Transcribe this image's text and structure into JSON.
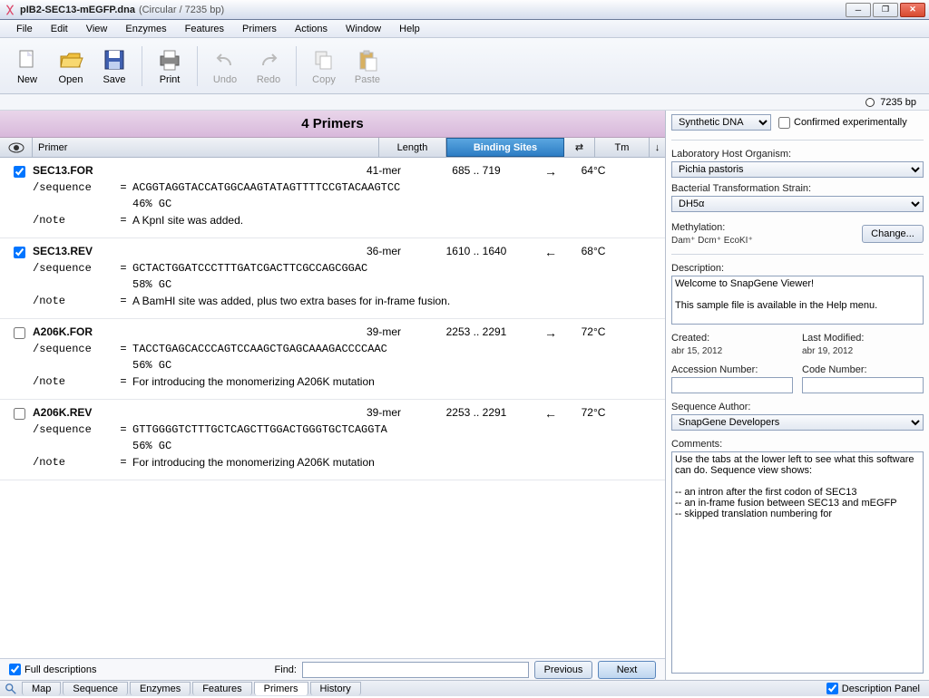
{
  "window": {
    "title_main": "pIB2-SEC13-mEGFP.dna",
    "title_sub": "(Circular / 7235 bp)"
  },
  "menu": [
    "File",
    "Edit",
    "View",
    "Enzymes",
    "Features",
    "Primers",
    "Actions",
    "Window",
    "Help"
  ],
  "toolbar": [
    {
      "label": "New",
      "icon": "new-icon",
      "disabled": false
    },
    {
      "label": "Open",
      "icon": "open-icon",
      "disabled": false
    },
    {
      "label": "Save",
      "icon": "save-icon",
      "disabled": false
    },
    {
      "label": "Print",
      "icon": "print-icon",
      "disabled": false
    },
    {
      "label": "Undo",
      "icon": "undo-icon",
      "disabled": true
    },
    {
      "label": "Redo",
      "icon": "redo-icon",
      "disabled": true
    },
    {
      "label": "Copy",
      "icon": "copy-icon",
      "disabled": true
    },
    {
      "label": "Paste",
      "icon": "paste-icon",
      "disabled": true
    }
  ],
  "infobar": {
    "size": "7235 bp"
  },
  "pane_header": "4 Primers",
  "columns": {
    "primer": "Primer",
    "length": "Length",
    "binding": "Binding Sites",
    "direction": "⇄",
    "tm": "Tm",
    "scroll": "↓"
  },
  "primers": [
    {
      "checked": true,
      "name": "SEC13.FOR",
      "length": "41-mer",
      "binding": "685  ..   719",
      "dir": "→",
      "tm": "64°C",
      "sequence": "ACGGTAGGTACCATGGCAAGTATAGTTTTCCGTACAAGTCC",
      "gc": "46% GC",
      "note": "A KpnI site was added."
    },
    {
      "checked": true,
      "name": "SEC13.REV",
      "length": "36-mer",
      "binding": "1610  ..  1640",
      "dir": "←",
      "tm": "68°C",
      "sequence": "GCTACTGGATCCCTTTGATCGACTTCGCCAGCGGAC",
      "gc": "58% GC",
      "note": "A BamHI site was added, plus two extra bases for in-frame fusion."
    },
    {
      "checked": false,
      "name": "A206K.FOR",
      "length": "39-mer",
      "binding": "2253  ..  2291",
      "dir": "→",
      "tm": "72°C",
      "sequence": "TACCTGAGCACCCAGTCCAAGCTGAGCAAAGACCCCAAC",
      "gc": "56% GC",
      "note": "For introducing the monomerizing A206K mutation"
    },
    {
      "checked": false,
      "name": "A206K.REV",
      "length": "39-mer",
      "binding": "2253  ..  2291",
      "dir": "←",
      "tm": "72°C",
      "sequence": "GTTGGGGTCTTTGCTCAGCTTGGACTGGGTGCTCAGGTA",
      "gc": "56% GC",
      "note": "For introducing the monomerizing A206K mutation"
    }
  ],
  "findbar": {
    "full_desc": "Full descriptions",
    "find_label": "Find:",
    "find_value": "",
    "previous": "Previous",
    "next": "Next"
  },
  "sidebar": {
    "type_selected": "Synthetic DNA",
    "confirmed_label": "Confirmed experimentally",
    "host_label": "Laboratory Host Organism:",
    "host_value": "Pichia pastoris",
    "strain_label": "Bacterial Transformation Strain:",
    "strain_value": "DH5α",
    "methyl_label": "Methylation:",
    "methyl_value": "Dam⁺  Dcm⁺  EcoKI⁺",
    "change": "Change...",
    "desc_label": "Description:",
    "desc_value": "Welcome to SnapGene Viewer!\n\nThis sample file is available in the Help menu.",
    "created_label": "Created:",
    "created_value": "abr 15, 2012",
    "modified_label": "Last Modified:",
    "modified_value": "abr 19, 2012",
    "acc_label": "Accession Number:",
    "acc_value": "",
    "code_label": "Code Number:",
    "code_value": "",
    "author_label": "Sequence Author:",
    "author_value": "SnapGene Developers",
    "comments_label": "Comments:",
    "comments_value": "Use the tabs at the lower left to see what this software can do. Sequence view shows:\n\n-- an intron after the first codon of SEC13\n-- an in-frame fusion between SEC13 and mEGFP\n-- skipped translation numbering for"
  },
  "bottom_tabs": [
    "Map",
    "Sequence",
    "Enzymes",
    "Features",
    "Primers",
    "History"
  ],
  "bottom_active": "Primers",
  "desc_panel": "Description Panel"
}
